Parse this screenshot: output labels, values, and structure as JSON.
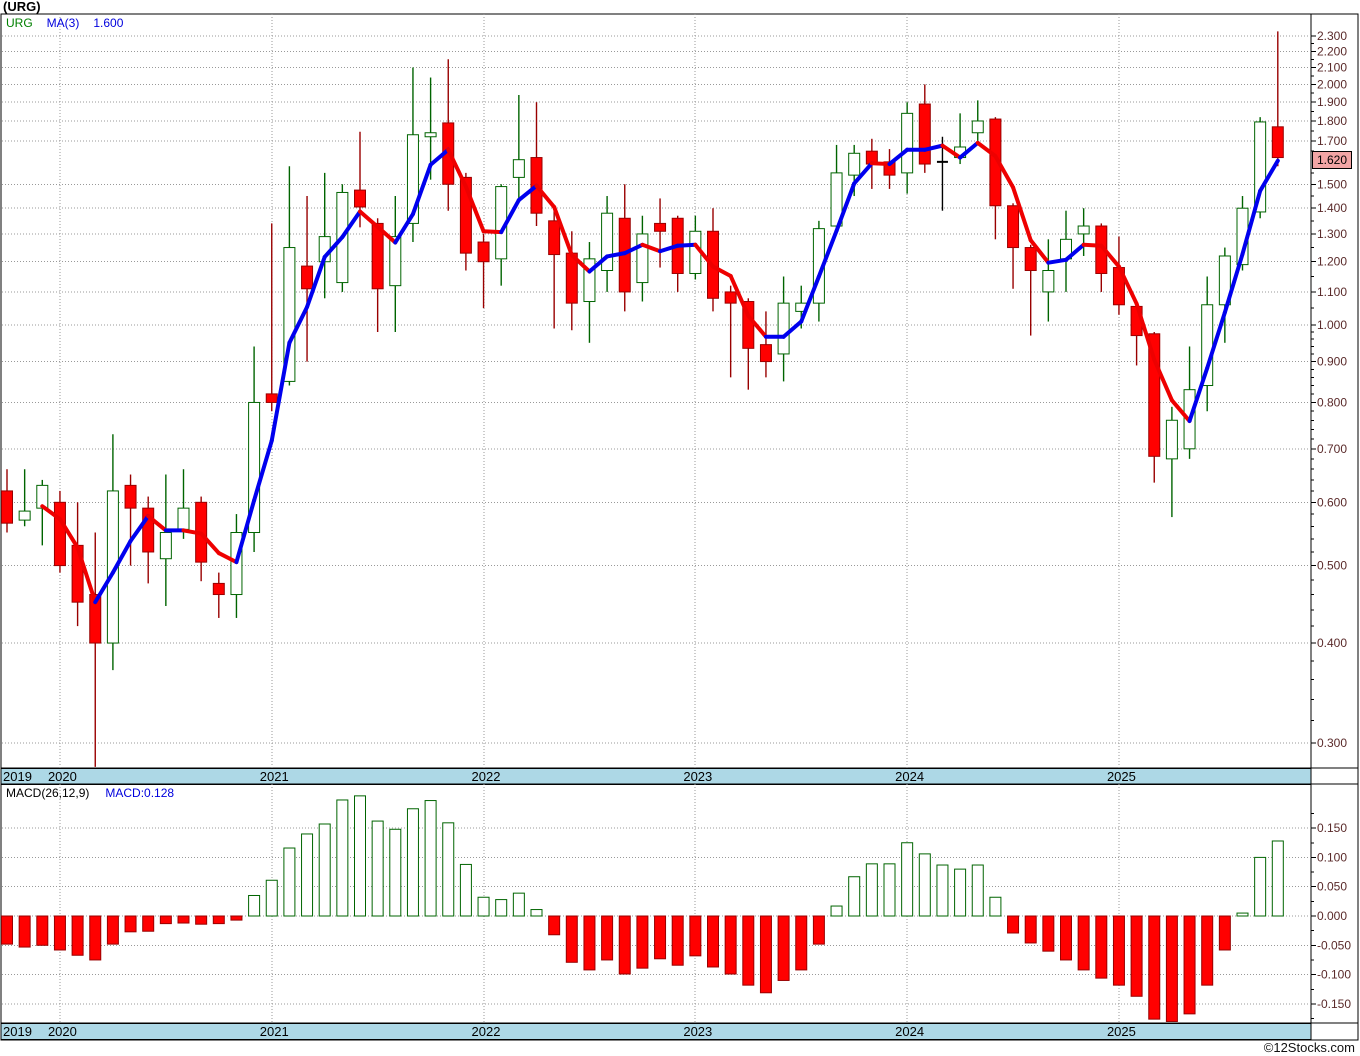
{
  "title": "(URG)",
  "main_chart": {
    "legend": {
      "symbol": "URG",
      "ma_label": "MA(3)",
      "ma_value": "1.600"
    },
    "price_badge": "1.620",
    "y_axis_labels": [
      "2.300",
      "2.200",
      "2.100",
      "2.000",
      "1.900",
      "1.800",
      "1.700",
      "1.500",
      "1.400",
      "1.300",
      "1.200",
      "1.100",
      "1.000",
      "0.900",
      "0.800",
      "0.700",
      "0.600",
      "0.500",
      "0.400",
      "0.300"
    ]
  },
  "macd_chart": {
    "indicator_label": "MACD(26,12,9)",
    "value_label": "MACD:0.128",
    "y_axis_labels": [
      "0.150",
      "0.100",
      "0.050",
      "0.000",
      "-0.050",
      "-0.100",
      "-0.150"
    ]
  },
  "x_axis": {
    "years": [
      "2019",
      "2020",
      "2021",
      "2022",
      "2023",
      "2024",
      "2025"
    ]
  },
  "watermark": "©12Stocks.com",
  "colors": {
    "up_outline": "#006400",
    "down_fill": "#FF0000",
    "down_border": "#990000",
    "doji": "#000000",
    "ma_rising": "#0000EE",
    "ma_falling": "#EE0000",
    "badge_bg": "#F2A5A5",
    "band_bg": "#ADD8E6",
    "axis_text": "#5A2A2A",
    "grid": "#999999"
  },
  "chart_data": [
    {
      "type": "candlestick",
      "title": "URG monthly price with MA(3) overlay",
      "yscale": "log",
      "ylim": [
        0.28,
        2.45
      ],
      "overlays": [
        {
          "name": "MA(3)",
          "style": "blue segments when rising, red when falling",
          "last_value": 1.6
        }
      ],
      "x": [
        "2019-10",
        "2019-11",
        "2019-12",
        "2020-01",
        "2020-02",
        "2020-03",
        "2020-04",
        "2020-05",
        "2020-06",
        "2020-07",
        "2020-08",
        "2020-09",
        "2020-10",
        "2020-11",
        "2020-12",
        "2021-01",
        "2021-02",
        "2021-03",
        "2021-04",
        "2021-05",
        "2021-06",
        "2021-07",
        "2021-08",
        "2021-09",
        "2021-10",
        "2021-11",
        "2021-12",
        "2022-01",
        "2022-02",
        "2022-03",
        "2022-04",
        "2022-05",
        "2022-06",
        "2022-07",
        "2022-08",
        "2022-09",
        "2022-10",
        "2022-11",
        "2022-12",
        "2023-01",
        "2023-02",
        "2023-03",
        "2023-04",
        "2023-05",
        "2023-06",
        "2023-07",
        "2023-08",
        "2023-09",
        "2023-10",
        "2023-11",
        "2023-12",
        "2024-01",
        "2024-02",
        "2024-03",
        "2024-04",
        "2024-05",
        "2024-06",
        "2024-07",
        "2024-08",
        "2024-09",
        "2024-10",
        "2024-11",
        "2024-12",
        "2025-01",
        "2025-02",
        "2025-03",
        "2025-04",
        "2025-05",
        "2025-06",
        "2025-07",
        "2025-08",
        "2025-09",
        "2025-10"
      ],
      "open": [
        0.62,
        0.57,
        0.59,
        0.6,
        0.53,
        0.46,
        0.4,
        0.63,
        0.59,
        0.51,
        0.555,
        0.6,
        0.475,
        0.46,
        0.55,
        0.82,
        0.85,
        1.185,
        1.2,
        1.13,
        1.475,
        1.34,
        1.12,
        1.34,
        1.72,
        1.79,
        1.53,
        1.27,
        1.21,
        1.53,
        1.62,
        1.35,
        1.23,
        1.07,
        1.17,
        1.36,
        1.13,
        1.34,
        1.36,
        1.16,
        1.31,
        1.1,
        1.07,
        0.945,
        0.92,
        1.04,
        1.065,
        1.33,
        1.54,
        1.65,
        1.6,
        1.55,
        1.89,
        1.6,
        1.62,
        1.74,
        1.81,
        1.41,
        1.25,
        1.1,
        1.21,
        1.3,
        1.33,
        1.18,
        1.055,
        0.975,
        0.68,
        0.7,
        0.84,
        1.06,
        1.19,
        1.385,
        1.77
      ],
      "high": [
        0.66,
        0.66,
        0.64,
        0.62,
        0.6,
        0.55,
        0.73,
        0.65,
        0.61,
        0.65,
        0.66,
        0.61,
        0.49,
        0.58,
        0.94,
        1.34,
        1.58,
        1.45,
        1.55,
        1.5,
        1.745,
        1.36,
        1.45,
        2.1,
        2.04,
        2.15,
        1.55,
        1.3,
        1.5,
        1.94,
        1.9,
        1.41,
        1.31,
        1.27,
        1.45,
        1.5,
        1.37,
        1.44,
        1.37,
        1.37,
        1.4,
        1.12,
        1.08,
        1.04,
        1.15,
        1.12,
        1.35,
        1.68,
        1.68,
        1.71,
        1.66,
        1.9,
        2.0,
        1.72,
        1.84,
        1.91,
        1.82,
        1.42,
        1.26,
        1.28,
        1.39,
        1.4,
        1.34,
        1.29,
        1.06,
        0.98,
        0.79,
        0.94,
        1.15,
        1.25,
        1.45,
        1.82,
        2.33
      ],
      "low": [
        0.55,
        0.56,
        0.53,
        0.49,
        0.42,
        0.28,
        0.37,
        0.5,
        0.475,
        0.445,
        0.54,
        0.478,
        0.43,
        0.43,
        0.52,
        0.78,
        0.84,
        0.9,
        1.08,
        1.1,
        1.325,
        0.98,
        0.98,
        1.27,
        1.52,
        1.39,
        1.17,
        1.05,
        1.12,
        1.44,
        1.33,
        0.99,
        0.985,
        0.95,
        1.1,
        1.04,
        1.07,
        1.18,
        1.1,
        1.14,
        1.04,
        0.86,
        0.83,
        0.86,
        0.85,
        0.99,
        1.01,
        1.31,
        1.45,
        1.48,
        1.48,
        1.46,
        1.55,
        1.39,
        1.59,
        1.7,
        1.28,
        1.11,
        0.97,
        1.01,
        1.1,
        1.22,
        1.1,
        1.03,
        0.89,
        0.635,
        0.575,
        0.68,
        0.78,
        0.95,
        1.17,
        1.36,
        1.58
      ],
      "close": [
        0.565,
        0.585,
        0.63,
        0.5,
        0.45,
        0.4,
        0.62,
        0.59,
        0.52,
        0.55,
        0.59,
        0.505,
        0.46,
        0.55,
        0.8,
        0.8,
        1.25,
        1.11,
        1.29,
        1.465,
        1.405,
        1.11,
        1.29,
        1.73,
        1.74,
        1.5,
        1.23,
        1.2,
        1.49,
        1.61,
        1.38,
        1.225,
        1.065,
        1.21,
        1.38,
        1.1,
        1.3,
        1.31,
        1.16,
        1.31,
        1.08,
        1.065,
        0.935,
        0.9,
        1.065,
        1.065,
        1.32,
        1.55,
        1.64,
        1.59,
        1.54,
        1.84,
        1.59,
        1.6,
        1.67,
        1.8,
        1.41,
        1.25,
        1.17,
        1.17,
        1.28,
        1.33,
        1.16,
        1.06,
        0.97,
        0.685,
        0.76,
        0.83,
        1.06,
        1.22,
        1.4,
        1.795,
        1.62
      ]
    },
    {
      "type": "bar",
      "title": "MACD(26,12,9) histogram",
      "ylabel": "MACD",
      "ylim": [
        -0.2,
        0.225
      ],
      "latest_value": 0.128,
      "x": [
        "2019-10",
        "2019-11",
        "2019-12",
        "2020-01",
        "2020-02",
        "2020-03",
        "2020-04",
        "2020-05",
        "2020-06",
        "2020-07",
        "2020-08",
        "2020-09",
        "2020-10",
        "2020-11",
        "2020-12",
        "2021-01",
        "2021-02",
        "2021-03",
        "2021-04",
        "2021-05",
        "2021-06",
        "2021-07",
        "2021-08",
        "2021-09",
        "2021-10",
        "2021-11",
        "2021-12",
        "2022-01",
        "2022-02",
        "2022-03",
        "2022-04",
        "2022-05",
        "2022-06",
        "2022-07",
        "2022-08",
        "2022-09",
        "2022-10",
        "2022-11",
        "2022-12",
        "2023-01",
        "2023-02",
        "2023-03",
        "2023-04",
        "2023-05",
        "2023-06",
        "2023-07",
        "2023-08",
        "2023-09",
        "2023-10",
        "2023-11",
        "2023-12",
        "2024-01",
        "2024-02",
        "2024-03",
        "2024-04",
        "2024-05",
        "2024-06",
        "2024-07",
        "2024-08",
        "2024-09",
        "2024-10",
        "2024-11",
        "2024-12",
        "2025-01",
        "2025-02",
        "2025-03",
        "2025-04",
        "2025-05",
        "2025-06",
        "2025-07",
        "2025-08",
        "2025-09",
        "2025-10"
      ],
      "values": [
        -0.048,
        -0.053,
        -0.05,
        -0.058,
        -0.067,
        -0.075,
        -0.048,
        -0.027,
        -0.026,
        -0.013,
        -0.012,
        -0.014,
        -0.013,
        -0.007,
        0.035,
        0.061,
        0.116,
        0.14,
        0.157,
        0.198,
        0.205,
        0.162,
        0.148,
        0.183,
        0.197,
        0.159,
        0.088,
        0.032,
        0.028,
        0.039,
        0.011,
        -0.032,
        -0.079,
        -0.092,
        -0.075,
        -0.099,
        -0.089,
        -0.073,
        -0.084,
        -0.068,
        -0.087,
        -0.099,
        -0.118,
        -0.131,
        -0.11,
        -0.092,
        -0.048,
        0.017,
        0.067,
        0.089,
        0.089,
        0.125,
        0.106,
        0.087,
        0.08,
        0.087,
        0.032,
        -0.029,
        -0.046,
        -0.06,
        -0.075,
        -0.092,
        -0.106,
        -0.118,
        -0.137,
        -0.176,
        -0.18,
        -0.167,
        -0.118,
        -0.058,
        0.005,
        0.1,
        0.128
      ]
    }
  ]
}
